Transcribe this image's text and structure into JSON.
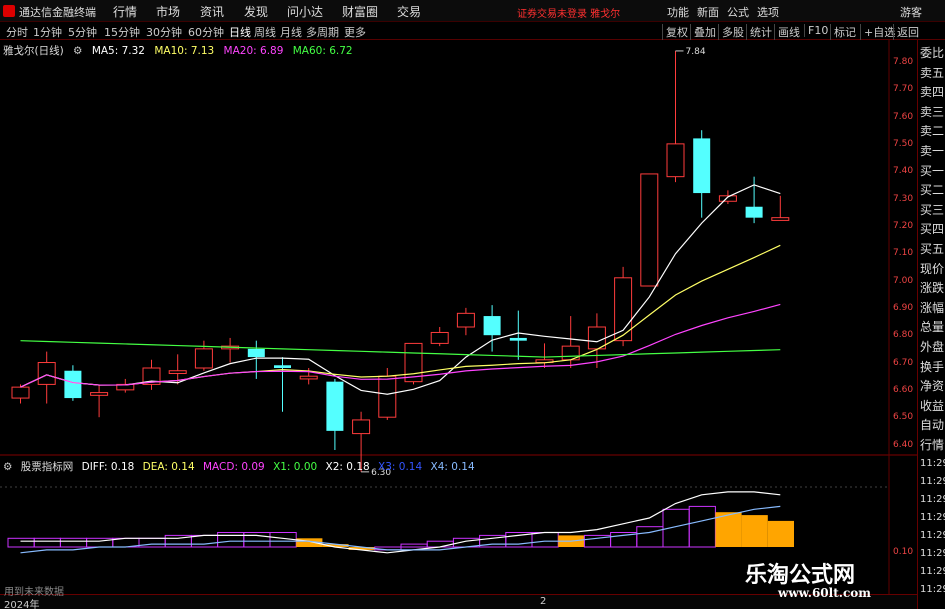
{
  "window": {
    "app_name": "通达信金融终端"
  },
  "menu": [
    "行情",
    "市场",
    "资讯",
    "发现",
    "问小达",
    "财富圈",
    "交易"
  ],
  "login_text": "证券交易未登录 雅戈尔",
  "right_menu": [
    "功能",
    "新面",
    "公式",
    "选项",
    "游客"
  ],
  "periods": [
    "分时",
    "1分钟",
    "5分钟",
    "15分钟",
    "30分钟",
    "60分钟",
    "日线",
    "周线",
    "月线",
    "多周期",
    "更多"
  ],
  "active_period": "日线",
  "tool_buttons": [
    "复权",
    "叠加",
    "多股",
    "统计",
    "画线",
    "F10",
    "标记",
    "+自选",
    "返回"
  ],
  "main_chart": {
    "stock": "雅戈尔(日线)",
    "ma": [
      {
        "label": "MA5: 7.32",
        "color": "#ffffff"
      },
      {
        "label": "MA10: 7.13",
        "color": "#ffff66"
      },
      {
        "label": "MA20: 6.89",
        "color": "#ff44ff"
      },
      {
        "label": "MA60: 6.72",
        "color": "#44ff44"
      }
    ],
    "high_label": "7.84",
    "low_label": "6.30",
    "y_ticks": [
      "7.80",
      "7.70",
      "7.60",
      "7.50",
      "7.40",
      "7.30",
      "7.20",
      "7.10",
      "7.00",
      "6.90",
      "6.80",
      "6.70",
      "6.60",
      "6.50",
      "6.40"
    ]
  },
  "indicator": {
    "name": "股票指标网",
    "values": [
      {
        "label": "DIFF: 0.18",
        "color": "#ffffff"
      },
      {
        "label": "DEA: 0.14",
        "color": "#ffff66"
      },
      {
        "label": "MACD: 0.09",
        "color": "#ff44ff"
      },
      {
        "label": "X1: 0.00",
        "color": "#44ff44"
      },
      {
        "label": "X2: 0.18",
        "color": "#ffffff"
      },
      {
        "label": "X3: 0.14",
        "color": "#3355ff"
      },
      {
        "label": "X4: 0.14",
        "color": "#88bbff"
      }
    ],
    "y_ticks": [
      "0.10"
    ]
  },
  "right_panel": [
    "委比",
    "卖五",
    "卖四",
    "卖三",
    "卖二",
    "卖一",
    "买一",
    "买二",
    "买三",
    "买四",
    "买五",
    "现价",
    "涨跌",
    "涨幅",
    "总量",
    "外盘",
    "换手",
    "净资",
    "收益",
    "自动",
    "行情"
  ],
  "right_panel_times": [
    "11:29",
    "11:29",
    "11:29",
    "11:29",
    "11:29",
    "11:29",
    "11:29",
    "11:29"
  ],
  "bottom": {
    "note": "用到未来数据",
    "year": "2024年",
    "mark": "2"
  },
  "watermark": {
    "title": "乐淘公式网",
    "url": "www.60lt.com"
  },
  "chart_data": {
    "type": "candlestick",
    "candles": [
      {
        "o": 6.57,
        "c": 6.61,
        "h": 6.62,
        "l": 6.55
      },
      {
        "o": 6.62,
        "c": 6.7,
        "h": 6.74,
        "l": 6.55
      },
      {
        "o": 6.67,
        "c": 6.57,
        "h": 6.69,
        "l": 6.56
      },
      {
        "o": 6.58,
        "c": 6.59,
        "h": 6.62,
        "l": 6.5
      },
      {
        "o": 6.6,
        "c": 6.62,
        "h": 6.64,
        "l": 6.59
      },
      {
        "o": 6.62,
        "c": 6.68,
        "h": 6.71,
        "l": 6.6
      },
      {
        "o": 6.66,
        "c": 6.67,
        "h": 6.73,
        "l": 6.62
      },
      {
        "o": 6.68,
        "c": 6.75,
        "h": 6.78,
        "l": 6.67
      },
      {
        "o": 6.75,
        "c": 6.76,
        "h": 6.79,
        "l": 6.7
      },
      {
        "o": 6.75,
        "c": 6.72,
        "h": 6.78,
        "l": 6.64
      },
      {
        "o": 6.69,
        "c": 6.68,
        "h": 6.72,
        "l": 6.52
      },
      {
        "o": 6.64,
        "c": 6.65,
        "h": 6.68,
        "l": 6.62
      },
      {
        "o": 6.63,
        "c": 6.45,
        "h": 6.64,
        "l": 6.38
      },
      {
        "o": 6.44,
        "c": 6.49,
        "h": 6.52,
        "l": 6.3
      },
      {
        "o": 6.5,
        "c": 6.65,
        "h": 6.68,
        "l": 6.49
      },
      {
        "o": 6.63,
        "c": 6.77,
        "h": 6.77,
        "l": 6.62
      },
      {
        "o": 6.77,
        "c": 6.81,
        "h": 6.83,
        "l": 6.76
      },
      {
        "o": 6.83,
        "c": 6.88,
        "h": 6.9,
        "l": 6.8
      },
      {
        "o": 6.87,
        "c": 6.8,
        "h": 6.91,
        "l": 6.74
      },
      {
        "o": 6.79,
        "c": 6.78,
        "h": 6.89,
        "l": 6.71
      },
      {
        "o": 6.7,
        "c": 6.71,
        "h": 6.77,
        "l": 6.68
      },
      {
        "o": 6.71,
        "c": 6.76,
        "h": 6.87,
        "l": 6.68
      },
      {
        "o": 6.75,
        "c": 6.83,
        "h": 6.88,
        "l": 6.68
      },
      {
        "o": 6.78,
        "c": 7.01,
        "h": 7.05,
        "l": 6.76
      },
      {
        "o": 6.98,
        "c": 7.39,
        "h": 7.39,
        "l": 6.98
      },
      {
        "o": 7.38,
        "c": 7.5,
        "h": 7.84,
        "l": 7.36
      },
      {
        "o": 7.52,
        "c": 7.32,
        "h": 7.55,
        "l": 7.23
      },
      {
        "o": 7.29,
        "c": 7.31,
        "h": 7.33,
        "l": 7.28
      },
      {
        "o": 7.27,
        "c": 7.23,
        "h": 7.38,
        "l": 7.21
      },
      {
        "o": 7.22,
        "c": 7.23,
        "h": 7.31,
        "l": 7.22
      }
    ],
    "ylim": [
      6.38,
      7.88
    ],
    "macd": [
      0.03,
      0.03,
      0.03,
      0.03,
      0.03,
      0.03,
      0.04,
      0.04,
      0.05,
      0.05,
      0.05,
      0.03,
      0.01,
      -0.01,
      -0.01,
      0.01,
      0.02,
      0.03,
      0.04,
      0.05,
      0.05,
      0.04,
      0.04,
      0.05,
      0.07,
      0.13,
      0.14,
      0.12,
      0.11,
      0.09
    ],
    "diff": [
      0.02,
      0.02,
      0.02,
      0.02,
      0.03,
      0.03,
      0.03,
      0.04,
      0.04,
      0.04,
      0.03,
      0.02,
      0.0,
      -0.01,
      -0.02,
      -0.01,
      0.0,
      0.02,
      0.03,
      0.04,
      0.05,
      0.05,
      0.06,
      0.08,
      0.1,
      0.15,
      0.18,
      0.19,
      0.19,
      0.18
    ],
    "dea": [
      -0.02,
      -0.01,
      -0.01,
      0.0,
      0.0,
      0.01,
      0.01,
      0.01,
      0.02,
      0.02,
      0.02,
      0.02,
      0.01,
      0.0,
      -0.01,
      -0.01,
      -0.01,
      0.0,
      0.01,
      0.01,
      0.02,
      0.02,
      0.03,
      0.04,
      0.05,
      0.07,
      0.09,
      0.11,
      0.13,
      0.14
    ]
  }
}
